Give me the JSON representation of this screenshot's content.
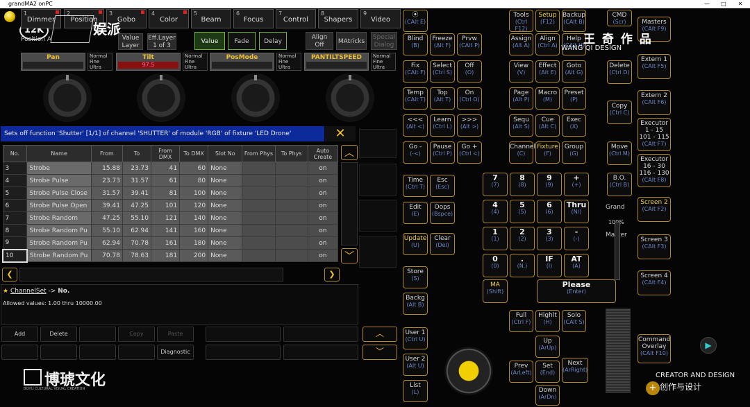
{
  "window": {
    "title": "grandMA2 onPC",
    "buttons": [
      "—",
      "□",
      "✕"
    ]
  },
  "branding": {
    "logo_left": "12K",
    "brand_cn": "娱派",
    "top_right_cn": "王 奇 作 品",
    "top_right_en": "WANG QI DESIGN",
    "bottom_left_cn": "博琥文化",
    "bottom_left_en": "BOHU CULTURAL VISUAL CREATION",
    "bottom_right_en": "CREATOR AND DESIGN",
    "bottom_right_cn": "创作与设计"
  },
  "feature_tabs": [
    {
      "num": "1",
      "label": "Dimmer"
    },
    {
      "num": "2",
      "label": "Position"
    },
    {
      "num": "3",
      "label": "Gobo"
    },
    {
      "num": "4",
      "label": "Color"
    },
    {
      "num": "5",
      "label": "Beam"
    },
    {
      "num": "6",
      "label": "Focus"
    },
    {
      "num": "7",
      "label": "Control"
    },
    {
      "num": "8",
      "label": "Shapers"
    },
    {
      "num": "9",
      "label": "Video"
    }
  ],
  "layer": {
    "position_label": "Position A",
    "value_layer": "Value Layer",
    "eff_layer": "Eff.Layer",
    "eff_layer_sub": "1 of 3",
    "value": "Value",
    "fade": "Fade",
    "delay": "Delay",
    "align_off": "Align Off",
    "matricks": "MAtricks",
    "special_dialog": "Special Dialog"
  },
  "attributes": [
    {
      "name": "Pan",
      "value": ""
    },
    {
      "name": "Tilt",
      "value": "97.5"
    },
    {
      "name": "PosMode",
      "value": ""
    },
    {
      "name": "PANTILTSPEED",
      "value": ""
    }
  ],
  "resolution": [
    "Normal",
    "Fine",
    "Ultra"
  ],
  "info_text": "Sets off function 'Shutter' [1/1] of channel 'SHUTTER' of module 'RGB' of fixture 'LED  Drone'",
  "close_icon": "✕",
  "table": {
    "headers": [
      "No.",
      "Name",
      "From",
      "To",
      "From DMX",
      "To DMX",
      "Slot No",
      "From Phys",
      "To Phys",
      "Auto Create"
    ],
    "rows": [
      [
        "3",
        "Strobe",
        "15.88",
        "23.73",
        "41",
        "60",
        "None",
        "",
        "",
        "on"
      ],
      [
        "4",
        "Strobe Pulse",
        "23.73",
        "31.57",
        "61",
        "80",
        "None",
        "",
        "",
        "on"
      ],
      [
        "5",
        "Strobe Pulse Close",
        "31.57",
        "39.41",
        "81",
        "100",
        "None",
        "",
        "",
        "on"
      ],
      [
        "6",
        "Strobe Pulse Open",
        "39.41",
        "47.25",
        "101",
        "120",
        "None",
        "",
        "",
        "on"
      ],
      [
        "7",
        "Strobe Random",
        "47.25",
        "55.10",
        "121",
        "140",
        "None",
        "",
        "",
        "on"
      ],
      [
        "8",
        "Strobe Random Pu",
        "55.10",
        "62.94",
        "141",
        "160",
        "None",
        "",
        "",
        "on"
      ],
      [
        "9",
        "Strobe Random Pu",
        "62.94",
        "70.78",
        "161",
        "180",
        "None",
        "",
        "",
        "on"
      ],
      [
        "10",
        "Strobe Random Pu",
        "70.78",
        "78.63",
        "181",
        "200",
        "None",
        "",
        "",
        "on"
      ]
    ]
  },
  "cmd": {
    "path": "ChannelSet",
    "arrow": "->",
    "target": "No.",
    "allowed": "Allowed values: 1.00 thru 10000.00"
  },
  "bottom_buttons": {
    "add": "Add",
    "delete": "Delete",
    "copy": "Copy",
    "paste": "Paste",
    "diagnostic": "Diagnostic"
  },
  "keys": {
    "col1": [
      {
        "l": "⦿",
        "s": "(CAlt E)"
      },
      {
        "l": "Blind",
        "s": "(B)"
      },
      {
        "l": "Fix",
        "s": "(CAlt F)"
      },
      {
        "l": "Temp",
        "s": "(CAlt T)"
      },
      {
        "l": "<<<",
        "s": "(Alt <)"
      },
      {
        "l": "Go -",
        "s": "(-<)"
      },
      {
        "l": "Time",
        "s": "(Ctrl T)"
      },
      {
        "l": "Edit",
        "s": "(E)"
      },
      {
        "l": "Update",
        "s": "(U)"
      },
      {
        "l": "Store",
        "s": "(S)"
      },
      {
        "l": "Backg",
        "s": "(Alt B)"
      },
      {
        "l": "User 1",
        "s": "(Ctrl U)"
      },
      {
        "l": "User 2",
        "s": "(Alt U)"
      },
      {
        "l": "List",
        "s": "(L)"
      }
    ],
    "col2": [
      {
        "l": "Freeze",
        "s": "(Alt F)"
      },
      {
        "l": "Select",
        "s": "(Ctrl S)"
      },
      {
        "l": "Top",
        "s": "(Alt T)"
      },
      {
        "l": "Learn",
        "s": "(Ctrl L)"
      },
      {
        "l": "Pause",
        "s": "(Ctrl P)"
      },
      {
        "l": "Esc",
        "s": "(Esc)"
      },
      {
        "l": "Oops",
        "s": "(Bspce)"
      },
      {
        "l": "Clear",
        "s": "(Del)"
      }
    ],
    "col3": [
      {
        "l": "Prvw",
        "s": "(CAlt P)"
      },
      {
        "l": "Off",
        "s": "(O)"
      },
      {
        "l": "On",
        "s": "(Ctrl O)"
      },
      {
        "l": ">>>",
        "s": "(Alt >)"
      },
      {
        "l": "Go +",
        "s": "(Ctrl <)"
      }
    ],
    "upper_grid": [
      [
        {
          "l": "Tools",
          "s": "(Ctrl F12)"
        },
        {
          "l": "Setup",
          "s": "(F12)"
        },
        {
          "l": "Backup",
          "s": "(CAlt B)"
        }
      ],
      [
        {
          "l": "Assign",
          "s": "(Alt A)"
        },
        {
          "l": "Align",
          "s": "(Ctrl A)"
        },
        {
          "l": "Help",
          "s": "(CAlt H)"
        }
      ],
      [
        {
          "l": "View",
          "s": "(V)"
        },
        {
          "l": "Effect",
          "s": "(Alt E)"
        },
        {
          "l": "Goto",
          "s": "(Alt G)"
        }
      ],
      [
        {
          "l": "Page",
          "s": "(Alt P)"
        },
        {
          "l": "Macro",
          "s": "(M)"
        },
        {
          "l": "Preset",
          "s": "(P)"
        }
      ],
      [
        {
          "l": "Sequ",
          "s": "(Alt S)"
        },
        {
          "l": "Cue",
          "s": "(Alt C)"
        },
        {
          "l": "Exec",
          "s": "(X)"
        }
      ],
      [
        {
          "l": "Channel",
          "s": "(C)"
        },
        {
          "l": "Fixture",
          "s": "(F)"
        },
        {
          "l": "Group",
          "s": "(G)"
        }
      ]
    ],
    "numpad": [
      [
        {
          "l": "7",
          "s": "(7)"
        },
        {
          "l": "8",
          "s": "(8)"
        },
        {
          "l": "9",
          "s": "(9)"
        },
        {
          "l": "+",
          "s": "(+)"
        }
      ],
      [
        {
          "l": "4",
          "s": "(4)"
        },
        {
          "l": "5",
          "s": "(5)"
        },
        {
          "l": "6",
          "s": "(6)"
        },
        {
          "l": "Thru",
          "s": "(N/)"
        }
      ],
      [
        {
          "l": "1",
          "s": "(1)"
        },
        {
          "l": "2",
          "s": "(2)"
        },
        {
          "l": "3",
          "s": "(3)"
        },
        {
          "l": "-",
          "s": "(-)"
        }
      ],
      [
        {
          "l": "0",
          "s": "(0)"
        },
        {
          "l": ".",
          "s": "(N.)"
        },
        {
          "l": "IF",
          "s": "(I)"
        },
        {
          "l": "AT",
          "s": "(A)"
        }
      ]
    ],
    "ma": {
      "l": "MA",
      "s": "(Shift)"
    },
    "please": {
      "l": "Please",
      "s": "(Enter)"
    },
    "full": {
      "l": "Full",
      "s": "(Ctrl F)"
    },
    "highlt": {
      "l": "Highlt",
      "s": "(H)"
    },
    "solo": {
      "l": "Solo",
      "s": "(CAlt S)"
    },
    "up": {
      "l": "Up",
      "s": "(ArUp)"
    },
    "prev": {
      "l": "Prev",
      "s": "(ArLeft)"
    },
    "set": {
      "l": "Set",
      "s": "(End)"
    },
    "next": {
      "l": "Next",
      "s": "(ArRight)"
    },
    "down": {
      "l": "Down",
      "s": "(ArDn)"
    },
    "cmd_key": {
      "l": "CMD",
      "s": "(Scr)"
    },
    "delete": {
      "l": "Delete",
      "s": "(Ctrl D)"
    },
    "copy": {
      "l": "Copy",
      "s": "(Ctrl C)"
    },
    "move": {
      "l": "Move",
      "s": "(Ctrl M)"
    },
    "bo": {
      "l": "B.O.",
      "s": "(Ctrl B)"
    },
    "grand": "Grand",
    "grand_pct": "100%",
    "master": "Master",
    "right": [
      {
        "l": "Masters",
        "s": "(CAlt F9)"
      },
      {
        "l": "Extern 1",
        "s": "(CAlt F5)"
      },
      {
        "l": "Extern 2",
        "s": "(CAlt F6)"
      },
      {
        "l": "Executor 1 - 15 101 - 115",
        "s": "(CAlt F7)"
      },
      {
        "l": "Executor 16 - 30 116 - 130",
        "s": "(CAlt F8)"
      },
      {
        "l": "Screen 2",
        "s": "(CAlt F2)"
      },
      {
        "l": "Screen 3",
        "s": "(CAlt F3)"
      },
      {
        "l": "Screen 4",
        "s": "(CAlt F4)"
      },
      {
        "l": "Command Overlay",
        "s": "(CAlt F10)"
      }
    ]
  }
}
